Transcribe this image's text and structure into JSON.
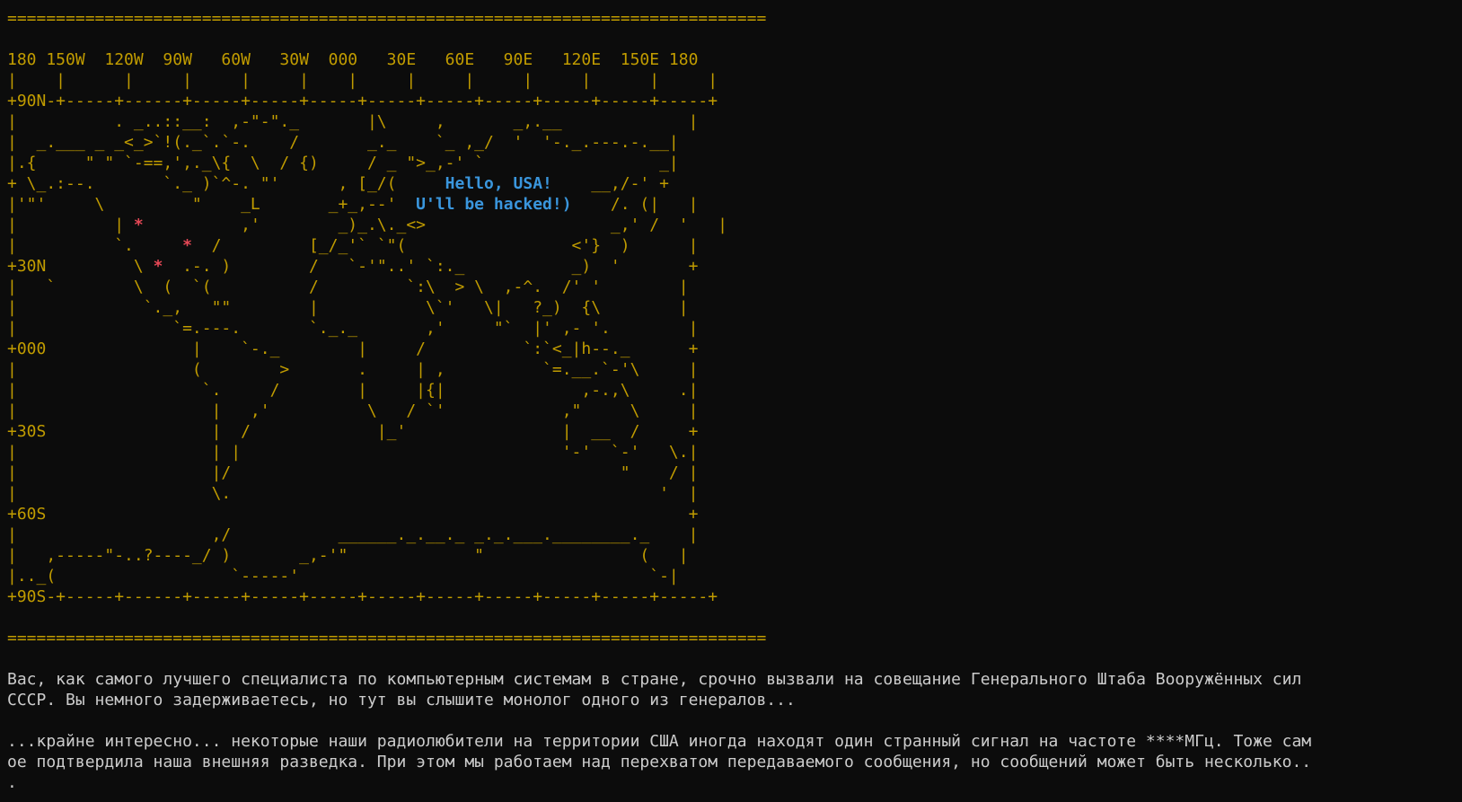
{
  "map": {
    "top_border": "==============================================================================",
    "longitudes": "180 150W  120W  90W   60W   30W  000   30E   60E   90E   120E  150E 180",
    "tick_line": "|    |      |     |     |     |    |     |     |     |     |      |     |",
    "rows": [
      {
        "segments": [
          {
            "text": "+90N-+-----+------+-----+-----+-----+-----+-----+-----+-----+-----+-----+",
            "kind": "map"
          }
        ]
      },
      {
        "segments": [
          {
            "text": "|          . _..::__:  ,-\"-\"._       |\\     ,       _,.__             |",
            "kind": "map"
          }
        ]
      },
      {
        "segments": [
          {
            "text": "|  _.___ _ _<_>`!(._`.`-.    /       _._    `_ ,_/  '  '-._.---.-.__|",
            "kind": "map"
          }
        ]
      },
      {
        "segments": [
          {
            "text": "|.{     \" \" `-==,',._\\{  \\  / {)     / _ \">_,-' `                  _|",
            "kind": "map"
          }
        ]
      },
      {
        "segments": [
          {
            "text": "+ \\_.:--.       `._ )`^-. \"'      , [_/(     ",
            "kind": "map"
          },
          {
            "text": "Hello, USA!",
            "kind": "hello"
          },
          {
            "text": "    __,/-' +",
            "kind": "map"
          }
        ]
      },
      {
        "segments": [
          {
            "text": "|'\"'     \\         \"    _L       _+_,--'  ",
            "kind": "map"
          },
          {
            "text": "U'll be hacked!)",
            "kind": "hello"
          },
          {
            "text": "    /. (|   |",
            "kind": "map"
          }
        ]
      },
      {
        "segments": [
          {
            "text": "|          | ",
            "kind": "map"
          },
          {
            "text": "*",
            "kind": "star"
          },
          {
            "text": "          ,'        _)_.\\._<>                   _,' /  '   |",
            "kind": "map"
          }
        ]
      },
      {
        "segments": [
          {
            "text": "|          `.     ",
            "kind": "map"
          },
          {
            "text": "*",
            "kind": "star"
          },
          {
            "text": "  /         [_/_'` `\"(                 <'}  )      |",
            "kind": "map"
          }
        ]
      },
      {
        "segments": [
          {
            "text": "+30N         \\ ",
            "kind": "map"
          },
          {
            "text": "*",
            "kind": "star"
          },
          {
            "text": "  .-. )        /   `-'\"..' `:._           _)  '       +",
            "kind": "map"
          }
        ]
      },
      {
        "segments": [
          {
            "text": "|   `        \\  (  `(          /         `:\\  > \\  ,-^.  /' '        |",
            "kind": "map"
          }
        ]
      },
      {
        "segments": [
          {
            "text": "|             `._,   \"\"        |           \\`'   \\|   ?_)  {\\        |",
            "kind": "map"
          }
        ]
      },
      {
        "segments": [
          {
            "text": "|                `=.---.       `._._       ,'     \"`  |' ,- '.        |",
            "kind": "map"
          }
        ]
      },
      {
        "segments": [
          {
            "text": "+000               |    `-._        |     /          `:`<_|h--._      +",
            "kind": "map"
          }
        ]
      },
      {
        "segments": [
          {
            "text": "|                  (        >       .     | ,          `=.__.`-'\\     |",
            "kind": "map"
          }
        ]
      },
      {
        "segments": [
          {
            "text": "|                   `.     /        |     |{|              ,-.,\\     .|",
            "kind": "map"
          }
        ]
      },
      {
        "segments": [
          {
            "text": "|                    |   ,'          \\   / `'            ,\"     \\     |",
            "kind": "map"
          }
        ]
      },
      {
        "segments": [
          {
            "text": "+30S                 |  /             |_'                |  __  /     +",
            "kind": "map"
          }
        ]
      },
      {
        "segments": [
          {
            "text": "|                    | |                                 '-'  `-'   \\.|",
            "kind": "map"
          }
        ]
      },
      {
        "segments": [
          {
            "text": "|                    |/                                        \"    / |",
            "kind": "map"
          }
        ]
      },
      {
        "segments": [
          {
            "text": "|                    \\.                                            '  |",
            "kind": "map"
          }
        ]
      },
      {
        "segments": [
          {
            "text": "+60S                                                                  +",
            "kind": "map"
          }
        ]
      },
      {
        "segments": [
          {
            "text": "|                    ,/           ______._.__._ _._.___.________._    |",
            "kind": "map"
          }
        ]
      },
      {
        "segments": [
          {
            "text": "|   ,-----\"-..?----_/ )       _,-'\"             \"                (   |",
            "kind": "map"
          }
        ]
      },
      {
        "segments": [
          {
            "text": "|.._(                  `-----'                                    `-|",
            "kind": "map"
          }
        ]
      },
      {
        "segments": [
          {
            "text": "+90S-+-----+------+-----+-----+-----+-----+-----+-----+-----+-----+-----+",
            "kind": "map"
          }
        ]
      }
    ],
    "bottom_border": "=============================================================================="
  },
  "story": {
    "para1": [
      "Вас, как самого лучшего специалиста по компьютерным системам в стране, срочно вызвали на совещание Генерального Штаба Вооружённых сил",
      "СССР. Вы немного задерживаетесь, но тут вы слышите монолог одного из генералов..."
    ],
    "para2": [
      "...крайне интересно... некоторые наши радиолюбители на территории США иногда находят один странный сигнал на частоте ****МГц. Тоже сам",
      "ое подтвердила наша внешняя разведка. При этом мы работаем над перехватом передаваемого сообщения, но сообщений может быть несколько..",
      "."
    ]
  },
  "colors": {
    "background": "#0c0c0c",
    "map": "#c19c00",
    "hello": "#3a96dd",
    "star": "#e74856",
    "text": "#cccccc"
  }
}
